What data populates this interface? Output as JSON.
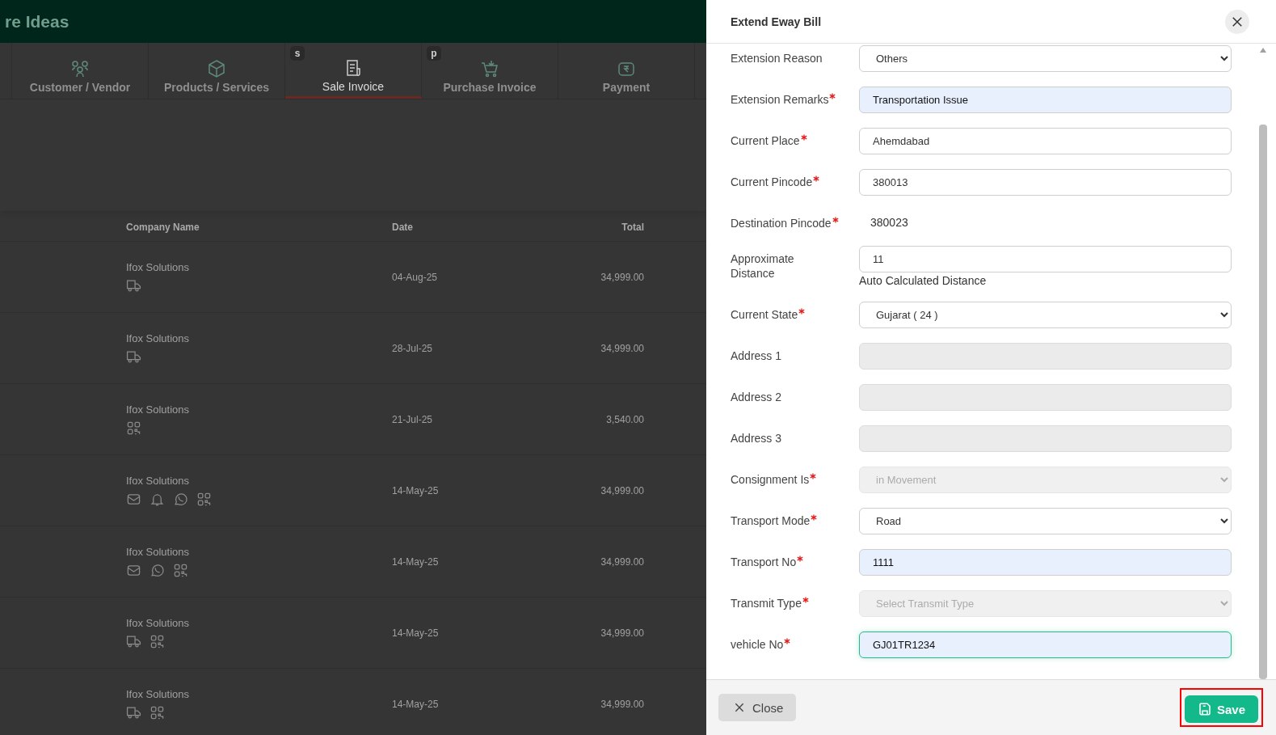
{
  "app": {
    "title": "re Ideas"
  },
  "tabs": [
    {
      "label": "Customer / Vendor",
      "kind": "people",
      "selected": false
    },
    {
      "label": "Products / Services",
      "kind": "box",
      "selected": false
    },
    {
      "label": "Sale Invoice",
      "kind": "invoice",
      "badge": "s",
      "selected": true
    },
    {
      "label": "Purchase Invoice",
      "kind": "cart",
      "badge": "p",
      "selected": false
    },
    {
      "label": "Payment",
      "kind": "payment",
      "selected": false
    }
  ],
  "table": {
    "columns": [
      "Company Name",
      "Date",
      "Total"
    ],
    "rows": [
      {
        "company": "Ifox Solutions",
        "icons": [
          {
            "kind": "truck"
          }
        ],
        "date": "04-Aug-25",
        "total": "34,999.00"
      },
      {
        "company": "Ifox Solutions",
        "icons": [
          {
            "kind": "truck"
          }
        ],
        "date": "28-Jul-25",
        "total": "34,999.00"
      },
      {
        "company": "Ifox Solutions",
        "icons": [
          {
            "kind": "qr"
          }
        ],
        "date": "21-Jul-25",
        "total": "3,540.00"
      },
      {
        "company": "Ifox Solutions",
        "icons": [
          {
            "kind": "mail"
          },
          {
            "kind": "bell"
          },
          {
            "kind": "chat"
          },
          {
            "kind": "qr"
          }
        ],
        "date": "14-May-25",
        "total": "34,999.00"
      },
      {
        "company": "Ifox Solutions",
        "icons": [
          {
            "kind": "mail"
          },
          {
            "kind": "chat"
          },
          {
            "kind": "qr"
          }
        ],
        "date": "14-May-25",
        "total": "34,999.00"
      },
      {
        "company": "Ifox Solutions",
        "icons": [
          {
            "kind": "truck"
          },
          {
            "kind": "qr"
          }
        ],
        "date": "14-May-25",
        "total": "34,999.00"
      },
      {
        "company": "Ifox Solutions",
        "icons": [
          {
            "kind": "truck"
          },
          {
            "kind": "qr"
          }
        ],
        "date": "14-May-25",
        "total": "34,999.00"
      }
    ]
  },
  "drawer": {
    "title": "Extend Eway Bill",
    "fields": [
      {
        "label": "Extension Reason",
        "kind": "select",
        "value": "Others",
        "required": false,
        "disabled": false,
        "autofilled": false,
        "focused": false
      },
      {
        "label": "Extension Remarks",
        "kind": "input",
        "value": "Transportation Issue",
        "required": true,
        "disabled": false,
        "autofilled": true,
        "focused": false
      },
      {
        "label": "Current Place",
        "kind": "input",
        "value": "Ahemdabad",
        "required": true,
        "disabled": false,
        "autofilled": false,
        "focused": false
      },
      {
        "label": "Current Pincode",
        "kind": "input",
        "value": "380013",
        "required": true,
        "disabled": false,
        "autofilled": false,
        "focused": false
      },
      {
        "label": "Destination Pincode",
        "kind": "text",
        "value": "380023",
        "required": true,
        "disabled": false,
        "autofilled": false,
        "focused": false
      },
      {
        "label": "Approximate Distance",
        "kind": "input",
        "value": "11",
        "help": "Auto Calculated Distance",
        "required": false,
        "disabled": false,
        "autofilled": false,
        "focused": false
      },
      {
        "label": "Current State",
        "kind": "select",
        "value": "Gujarat ( 24 )",
        "required": true,
        "disabled": false,
        "autofilled": false,
        "focused": false
      },
      {
        "label": "Address 1",
        "kind": "input",
        "required": false,
        "disabled": true,
        "autofilled": false,
        "focused": false
      },
      {
        "label": "Address 2",
        "kind": "input",
        "required": false,
        "disabled": true,
        "autofilled": false,
        "focused": false
      },
      {
        "label": "Address 3",
        "kind": "input",
        "required": false,
        "disabled": true,
        "autofilled": false,
        "focused": false
      },
      {
        "label": "Consignment Is",
        "kind": "select",
        "value": "in Movement",
        "required": true,
        "disabled": true,
        "autofilled": false,
        "focused": false
      },
      {
        "label": "Transport Mode",
        "kind": "select",
        "value": "Road",
        "required": true,
        "disabled": false,
        "autofilled": false,
        "focused": false
      },
      {
        "label": "Transport No",
        "kind": "input",
        "value": "1111",
        "required": true,
        "disabled": false,
        "autofilled": true,
        "focused": false
      },
      {
        "label": "Transmit Type",
        "kind": "select",
        "placeholder": "Select Transmit Type",
        "required": true,
        "disabled": true,
        "autofilled": false,
        "focused": false
      },
      {
        "label": "vehicle No",
        "kind": "input",
        "value": "GJ01TR1234",
        "required": true,
        "disabled": false,
        "autofilled": true,
        "focused": true
      }
    ],
    "close_button": "Close",
    "save_button": {
      "label": "Save",
      "highlighted": true
    }
  }
}
